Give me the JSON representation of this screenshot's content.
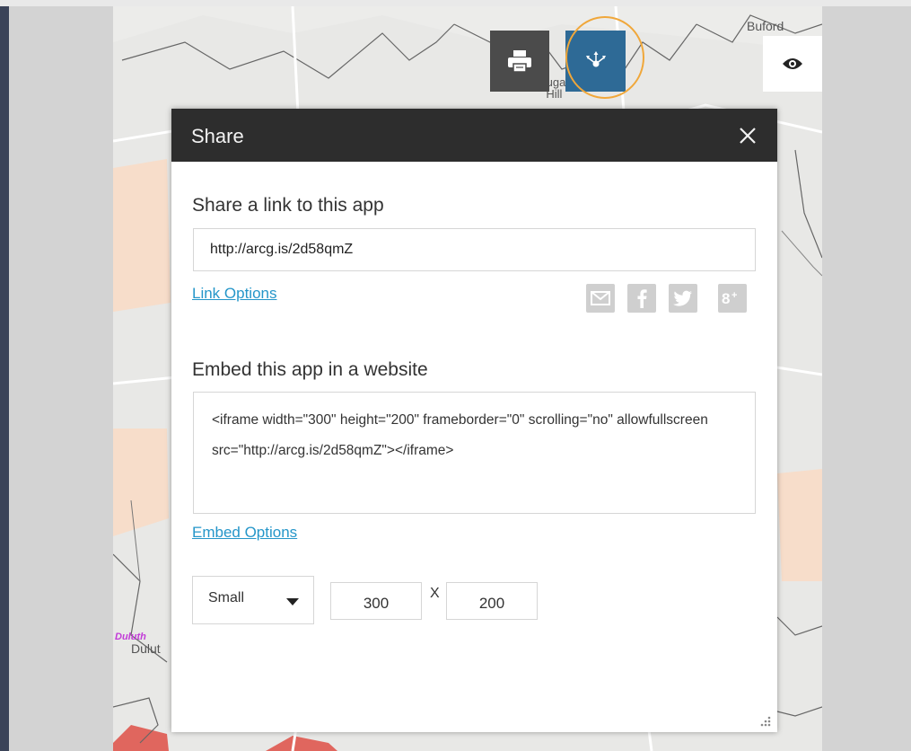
{
  "map": {
    "labels": {
      "buford": "Buford",
      "sugar_hill": "Sugar\nHill",
      "duluth_pink": "Duluth",
      "duluth": "Dulut"
    }
  },
  "toolbar": {
    "print_icon": "printer-icon",
    "share_icon": "share-icon",
    "visibility_icon": "eye-icon",
    "active_color": "#2e6a96",
    "highlight_color": "#f0a73a"
  },
  "dialog": {
    "title": "Share",
    "close_icon": "close-icon",
    "share_link": {
      "heading": "Share a link to this app",
      "url": "http://arcg.is/2d58qmZ",
      "options_label": "Link Options",
      "social": [
        "email-icon",
        "facebook-icon",
        "twitter-icon",
        "google-plus-icon"
      ]
    },
    "embed": {
      "heading": "Embed this app in a website",
      "code": "<iframe width=\"300\" height=\"200\" frameborder=\"0\" scrolling=\"no\" allowfullscreen src=\"http://arcg.is/2d58qmZ\"></iframe>",
      "options_label": "Embed Options",
      "size_selected": "Small",
      "width": "300",
      "separator": "X",
      "height": "200"
    }
  }
}
